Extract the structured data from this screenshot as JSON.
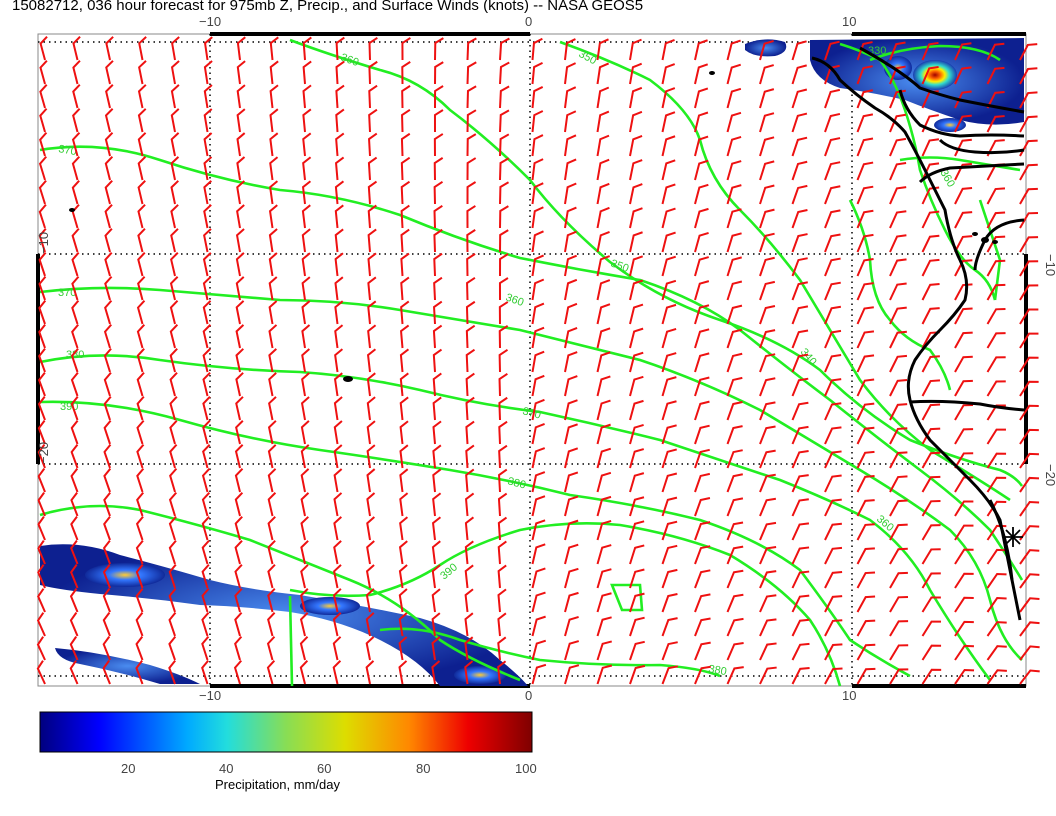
{
  "title": "15082712, 036 hour forecast for 975mb Z, Precip., and Surface Winds (knots) -- NASA GEOS5",
  "axes": {
    "lon_ticks": [
      "−10",
      "0",
      "10"
    ],
    "lat_ticks": [
      "−10",
      "−20"
    ]
  },
  "contour_labels": [
    "330",
    "350",
    "360",
    "370",
    "340",
    "360",
    "370",
    "380",
    "390",
    "350",
    "360",
    "370",
    "380",
    "390",
    "360",
    "380"
  ],
  "colorbar": {
    "ticks": [
      "20",
      "40",
      "60",
      "80",
      "100"
    ],
    "label": "Precipitation, mm/day"
  },
  "colors": {
    "contour": "#22ee22",
    "wind_barb": "#ee1111",
    "coastline": "#000000",
    "precip_low": "#0a1a8a",
    "precip_high": "#cc2200"
  },
  "icons": {
    "station_marker": "asterisk-icon"
  }
}
